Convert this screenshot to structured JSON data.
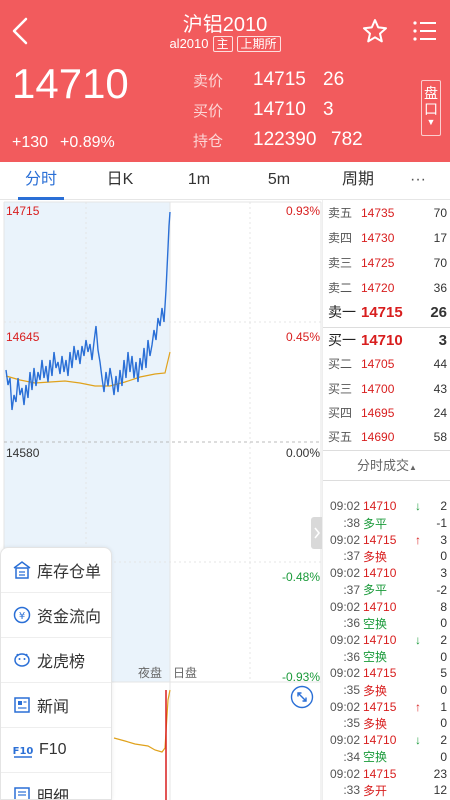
{
  "header": {
    "title": "沪铝2010",
    "code": "al2010",
    "tag_main": "主",
    "tag_exchange": "上期所",
    "price": "14710",
    "change_abs": "+130",
    "change_pct": "+0.89%",
    "sell_label": "卖价",
    "sell_price": "14715",
    "sell_vol": "26",
    "buy_label": "买价",
    "buy_price": "14710",
    "buy_vol": "3",
    "oi_label": "持仓",
    "oi_value": "122390",
    "oi_change": "782",
    "pan_label": "盘口",
    "colors": {
      "bg": "#f25b5d"
    }
  },
  "tabs": [
    {
      "label": "分时",
      "active": true
    },
    {
      "label": "日K"
    },
    {
      "label": "1m"
    },
    {
      "label": "5m"
    },
    {
      "label": "周期"
    },
    {
      "label": "···"
    }
  ],
  "chart": {
    "levels": [
      {
        "price": "14715",
        "pct": "0.93%",
        "tone": "red"
      },
      {
        "price": "14645",
        "pct": "0.45%",
        "tone": "red"
      },
      {
        "price": "14580",
        "pct": "0.00%",
        "tone": "dark"
      },
      {
        "price": "",
        "pct": "-0.48%",
        "tone": "green"
      },
      {
        "price": "",
        "pct": "-0.93%",
        "tone": "green"
      }
    ],
    "session_night": "夜盘",
    "session_day": "日盘",
    "colors": {
      "line": "#2a6fd6",
      "avg": "#e0a21c",
      "fill": "#eaf3fb"
    }
  },
  "book": {
    "asks": [
      {
        "label": "卖五",
        "price": "14735",
        "vol": "70"
      },
      {
        "label": "卖四",
        "price": "14730",
        "vol": "17"
      },
      {
        "label": "卖三",
        "price": "14725",
        "vol": "70"
      },
      {
        "label": "卖二",
        "price": "14720",
        "vol": "36"
      },
      {
        "label": "卖一",
        "price": "14715",
        "vol": "26"
      }
    ],
    "bids": [
      {
        "label": "买一",
        "price": "14710",
        "vol": "3"
      },
      {
        "label": "买二",
        "price": "14705",
        "vol": "44"
      },
      {
        "label": "买三",
        "price": "14700",
        "vol": "43"
      },
      {
        "label": "买四",
        "price": "14695",
        "vol": "24"
      },
      {
        "label": "买五",
        "price": "14690",
        "vol": "58"
      }
    ],
    "trades_title": "分时成交",
    "trades": [
      {
        "time": "09:02",
        "text": "14710",
        "arrow": "↓",
        "qty": "2",
        "tone": "red",
        "arrow_tone": "green"
      },
      {
        "time": ":38",
        "text": "多平",
        "arrow": "",
        "qty": "-1",
        "tone": "green"
      },
      {
        "time": "09:02",
        "text": "14715",
        "arrow": "↑",
        "qty": "3",
        "tone": "red",
        "arrow_tone": "red"
      },
      {
        "time": ":37",
        "text": "多换",
        "arrow": "",
        "qty": "0",
        "tone": "red"
      },
      {
        "time": "09:02",
        "text": "14710",
        "arrow": "",
        "qty": "3",
        "tone": "red"
      },
      {
        "time": ":37",
        "text": "多平",
        "arrow": "",
        "qty": "-2",
        "tone": "green"
      },
      {
        "time": "09:02",
        "text": "14710",
        "arrow": "",
        "qty": "8",
        "tone": "red"
      },
      {
        "time": ":36",
        "text": "空换",
        "arrow": "",
        "qty": "0",
        "tone": "green"
      },
      {
        "time": "09:02",
        "text": "14710",
        "arrow": "↓",
        "qty": "2",
        "tone": "red",
        "arrow_tone": "green"
      },
      {
        "time": ":36",
        "text": "空换",
        "arrow": "",
        "qty": "0",
        "tone": "green"
      },
      {
        "time": "09:02",
        "text": "14715",
        "arrow": "",
        "qty": "5",
        "tone": "red"
      },
      {
        "time": ":35",
        "text": "多换",
        "arrow": "",
        "qty": "0",
        "tone": "red"
      },
      {
        "time": "09:02",
        "text": "14715",
        "arrow": "↑",
        "qty": "1",
        "tone": "red",
        "arrow_tone": "red"
      },
      {
        "time": ":35",
        "text": "多换",
        "arrow": "",
        "qty": "0",
        "tone": "red"
      },
      {
        "time": "09:02",
        "text": "14710",
        "arrow": "↓",
        "qty": "2",
        "tone": "red",
        "arrow_tone": "green"
      },
      {
        "time": ":34",
        "text": "空换",
        "arrow": "",
        "qty": "0",
        "tone": "green"
      },
      {
        "time": "09:02",
        "text": "14715",
        "arrow": "",
        "qty": "23",
        "tone": "red"
      },
      {
        "time": ":33",
        "text": "多开",
        "arrow": "",
        "qty": "12",
        "tone": "red"
      }
    ]
  },
  "side_menu": [
    {
      "label": "库存仓单",
      "icon": "warehouse-icon"
    },
    {
      "label": "资金流向",
      "icon": "money-flow-icon"
    },
    {
      "label": "龙虎榜",
      "icon": "dragon-tiger-icon"
    },
    {
      "label": "新闻",
      "icon": "news-icon"
    },
    {
      "label": "F10",
      "icon": "f10-icon"
    },
    {
      "label": "明细",
      "icon": "detail-icon"
    }
  ]
}
